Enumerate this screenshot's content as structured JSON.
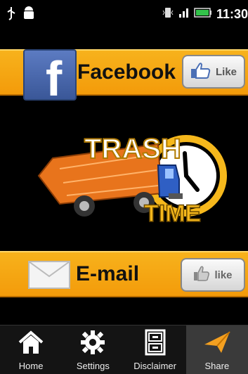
{
  "status": {
    "time": "11:30"
  },
  "facebook": {
    "label": "Facebook",
    "like_label": "Like"
  },
  "email": {
    "label": "E-mail",
    "like_label": "like"
  },
  "logo": {
    "line1": "TRASH",
    "line2": "TIME"
  },
  "nav": [
    {
      "label": "Home",
      "icon": "home-icon"
    },
    {
      "label": "Settings",
      "icon": "gear-icon"
    },
    {
      "label": "Disclaimer",
      "icon": "cabinet-icon"
    },
    {
      "label": "Share",
      "icon": "share-icon"
    }
  ],
  "colors": {
    "banner": "#f7b21c",
    "facebook_blue": "#3a5798",
    "accent_share": "#f4a020"
  }
}
